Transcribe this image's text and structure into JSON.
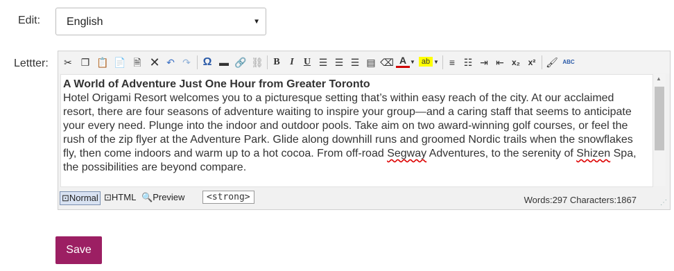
{
  "edit": {
    "label": "Edit:",
    "selected": "English"
  },
  "letter": {
    "label": "Lettter:"
  },
  "toolbar": {
    "bold": "B",
    "italic": "I",
    "underline": "U",
    "omega": "Ω",
    "subscript": "x₂",
    "superscript": "x²",
    "font_color_letter": "A",
    "highlight_letters": "ab",
    "spell": "ABC"
  },
  "content": {
    "title": "A World of Adventure Just One Hour from Greater Toronto",
    "body_1": "Hotel Origami Resort welcomes you to a picturesque setting that’s within easy reach of the city. At our acclaimed resort, there are four seasons of adventure waiting to inspire your group—and a caring staff that seems to anticipate your every need. Plunge into the indoor and outdoor pools. Take aim on two award-winning golf courses, or feel the rush of the zip flyer at the Adventure Park. Glide along downhill runs and groomed Nordic trails when the snowflakes fly, then come indoors and warm up to a hot cocoa. From off-road ",
    "word_segway": "Segway",
    "body_2": " Adventures, to the serenity of ",
    "word_shizen": "Shizen",
    "body_3": " Spa, the possibilities are beyond compare."
  },
  "status": {
    "mode_normal": "Normal",
    "mode_html": "HTML",
    "mode_preview": "Preview",
    "tag": "<strong>",
    "counts": "Words:297 Characters:1867"
  },
  "save_label": "Save",
  "colors": {
    "save": "#9c1f63",
    "font_color": "#d00000",
    "highlight": "#ffff00"
  }
}
